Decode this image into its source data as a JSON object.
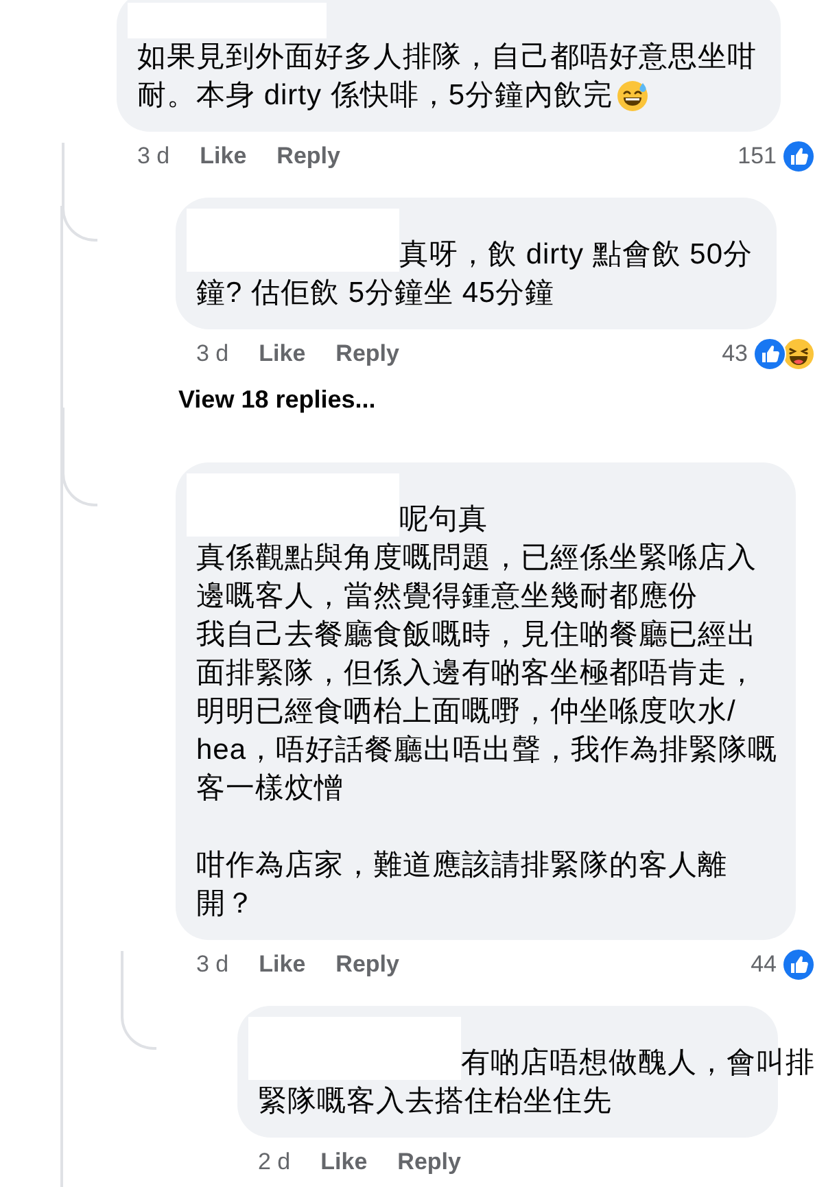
{
  "comments": [
    {
      "name_redacted": true,
      "paragraphs": [
        [
          "如果見到外面好多人排隊，自己都唔好意思坐咁",
          "耐。本身 dirty 係快啡，5分鐘內飲完"
        ]
      ],
      "emoji": {
        "kind": "sweat-smile"
      },
      "time": "3 d",
      "like": "Like",
      "reply": "Reply",
      "count": "151",
      "reactions": [
        {
          "kind": "like"
        }
      ],
      "children": [
        {
          "name_redacted": true,
          "paragraphs": [
            [
              "真呀，飲 dirty 點會飲 50分",
              "鐘? 估佢飲 5分鐘坐 45分鐘"
            ]
          ],
          "time": "3 d",
          "like": "Like",
          "reply": "Reply",
          "count": "43",
          "reactions": [
            {
              "kind": "like"
            },
            {
              "kind": "haha"
            }
          ],
          "more_replies": "View 18 replies..."
        },
        {
          "name_redacted": true,
          "paragraphs": [
            [
              "呢句真",
              "真係觀點與角度嘅問題，已經係坐緊喺店入",
              "邊嘅客人，當然覺得鍾意坐幾耐都應份",
              "我自己去餐廳食飯嘅時，見住啲餐廳已經出",
              "面排緊隊，但係入邊有啲客坐極都唔肯走，",
              "明明已經食哂枱上面嘅嘢，仲坐喺度吹水/",
              "hea，唔好話餐廳出唔出聲，我作為排緊隊嘅",
              "客一樣炆憎"
            ],
            [
              "咁作為店家，難道應該請排緊隊的客人離",
              "開？"
            ]
          ],
          "time": "3 d",
          "like": "Like",
          "reply": "Reply",
          "count": "44",
          "reactions": [
            {
              "kind": "like"
            }
          ],
          "children": [
            {
              "name_redacted": true,
              "paragraphs": [
                [
                  "有啲店唔想做醜人，會叫排",
                  "緊隊嘅客入去搭住枱坐住先"
                ]
              ],
              "time": "2 d",
              "like": "Like",
              "reply": "Reply"
            }
          ]
        }
      ]
    }
  ]
}
